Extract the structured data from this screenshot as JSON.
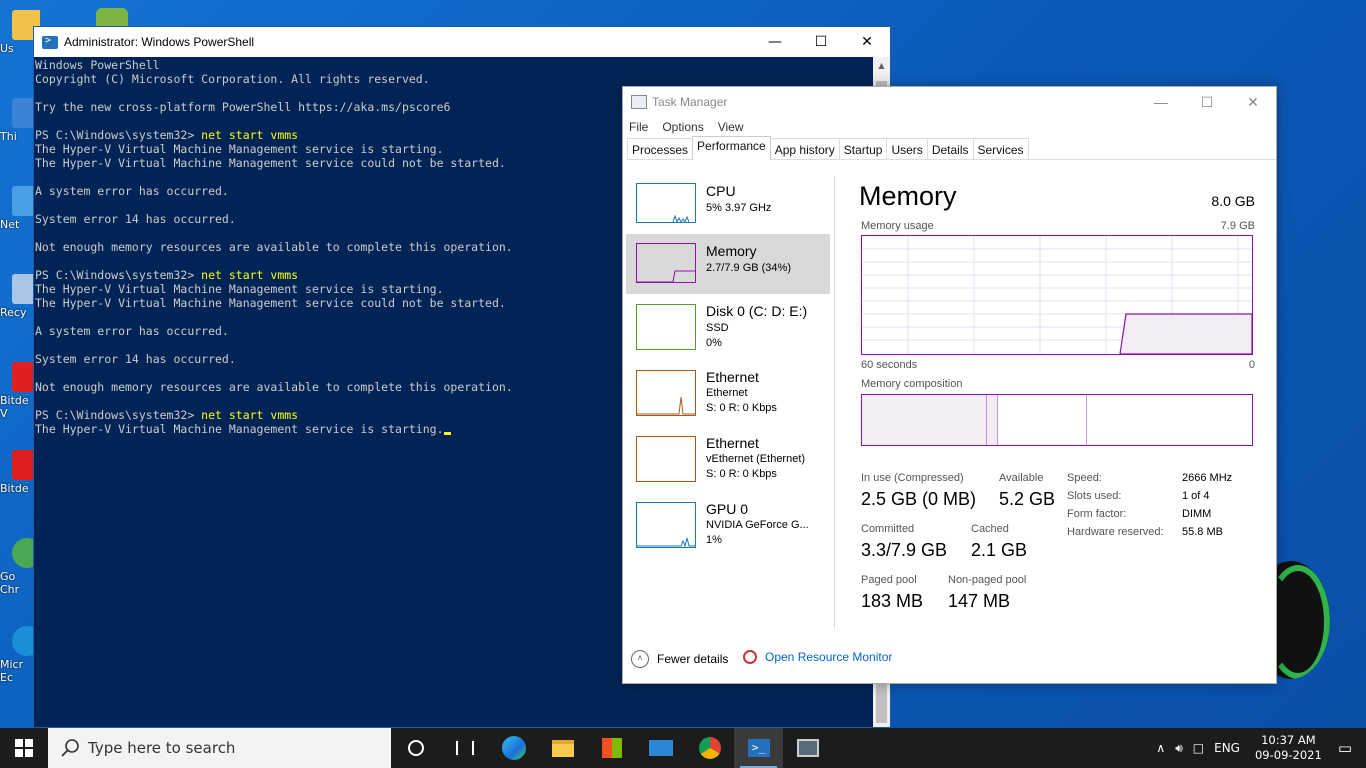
{
  "desktop": {
    "icons": [
      {
        "label": "Us",
        "color": "#f1c24b"
      },
      {
        "label": "Thi",
        "color": "#3b83d6"
      },
      {
        "label": "Net",
        "color": "#4aa0e2"
      },
      {
        "label": "Recy",
        "color": "#a9c6e8"
      },
      {
        "label": "Bitde\nV",
        "color": "#e02020"
      },
      {
        "label": "Bitde",
        "color": "#e02020"
      },
      {
        "label": "Go\nChr",
        "color": "#4aa854"
      },
      {
        "label": "Micr\nEc",
        "color": "#1a8fd8"
      }
    ]
  },
  "powershell": {
    "title": "Administrator: Windows PowerShell",
    "lines": [
      {
        "text": "Windows PowerShell"
      },
      {
        "text": "Copyright (C) Microsoft Corporation. All rights reserved."
      },
      {
        "text": ""
      },
      {
        "text": "Try the new cross-platform PowerShell https://aka.ms/pscore6"
      },
      {
        "text": ""
      },
      {
        "prompt": "PS C:\\Windows\\system32> ",
        "cmd": "net start vmms"
      },
      {
        "text": "The Hyper-V Virtual Machine Management service is starting."
      },
      {
        "text": "The Hyper-V Virtual Machine Management service could not be started."
      },
      {
        "text": ""
      },
      {
        "text": "A system error has occurred."
      },
      {
        "text": ""
      },
      {
        "text": "System error 14 has occurred."
      },
      {
        "text": ""
      },
      {
        "text": "Not enough memory resources are available to complete this operation."
      },
      {
        "text": ""
      },
      {
        "prompt": "PS C:\\Windows\\system32> ",
        "cmd": "net start vmms"
      },
      {
        "text": "The Hyper-V Virtual Machine Management service is starting."
      },
      {
        "text": "The Hyper-V Virtual Machine Management service could not be started."
      },
      {
        "text": ""
      },
      {
        "text": "A system error has occurred."
      },
      {
        "text": ""
      },
      {
        "text": "System error 14 has occurred."
      },
      {
        "text": ""
      },
      {
        "text": "Not enough memory resources are available to complete this operation."
      },
      {
        "text": ""
      },
      {
        "prompt": "PS C:\\Windows\\system32> ",
        "cmd": "net start vmms"
      },
      {
        "text": "The Hyper-V Virtual Machine Management service is starting.",
        "cursor": true
      }
    ]
  },
  "taskmanager": {
    "title": "Task Manager",
    "menu": [
      "File",
      "Options",
      "View"
    ],
    "tabs": [
      "Processes",
      "Performance",
      "App history",
      "Startup",
      "Users",
      "Details",
      "Services"
    ],
    "active_tab": "Performance",
    "resources": [
      {
        "name": "CPU",
        "sub1": "5% 3.97 GHz",
        "sub2": "",
        "color": "#1f78b4"
      },
      {
        "name": "Memory",
        "sub1": "2.7/7.9 GB (34%)",
        "sub2": "",
        "color": "#8b12ae",
        "selected": true
      },
      {
        "name": "Disk 0 (C: D: E:)",
        "sub1": "SSD",
        "sub2": "0%",
        "color": "#4da12a"
      },
      {
        "name": "Ethernet",
        "sub1": "Ethernet",
        "sub2": "S: 0 R: 0 Kbps",
        "color": "#a7591a"
      },
      {
        "name": "Ethernet",
        "sub1": "vEthernet (Ethernet)",
        "sub2": "S: 0 R: 0 Kbps",
        "color": "#a7591a"
      },
      {
        "name": "GPU 0",
        "sub1": "NVIDIA GeForce G...",
        "sub2": "1%",
        "color": "#1f78b4"
      }
    ],
    "memory": {
      "title": "Memory",
      "total": "8.0 GB",
      "usage_label": "Memory usage",
      "usage_max": "7.9 GB",
      "axis_left": "60 seconds",
      "axis_right": "0",
      "composition_label": "Memory composition",
      "in_use_label": "In use (Compressed)",
      "in_use_value": "2.5 GB (0 MB)",
      "available_label": "Available",
      "available_value": "5.2 GB",
      "committed_label": "Committed",
      "committed_value": "3.3/7.9 GB",
      "cached_label": "Cached",
      "cached_value": "2.1 GB",
      "paged_label": "Paged pool",
      "paged_value": "183 MB",
      "nonpaged_label": "Non-paged pool",
      "nonpaged_value": "147 MB",
      "speed_label": "Speed:",
      "speed_value": "2666 MHz",
      "slots_label": "Slots used:",
      "slots_value": "1 of 4",
      "form_label": "Form factor:",
      "form_value": "DIMM",
      "hw_label": "Hardware reserved:",
      "hw_value": "55.8 MB"
    },
    "footer": {
      "fewer": "Fewer details",
      "resource_monitor": "Open Resource Monitor"
    }
  },
  "taskbar": {
    "search_placeholder": "Type here to search",
    "lang": "ENG",
    "time": "10:37 AM",
    "date": "09-09-2021"
  }
}
